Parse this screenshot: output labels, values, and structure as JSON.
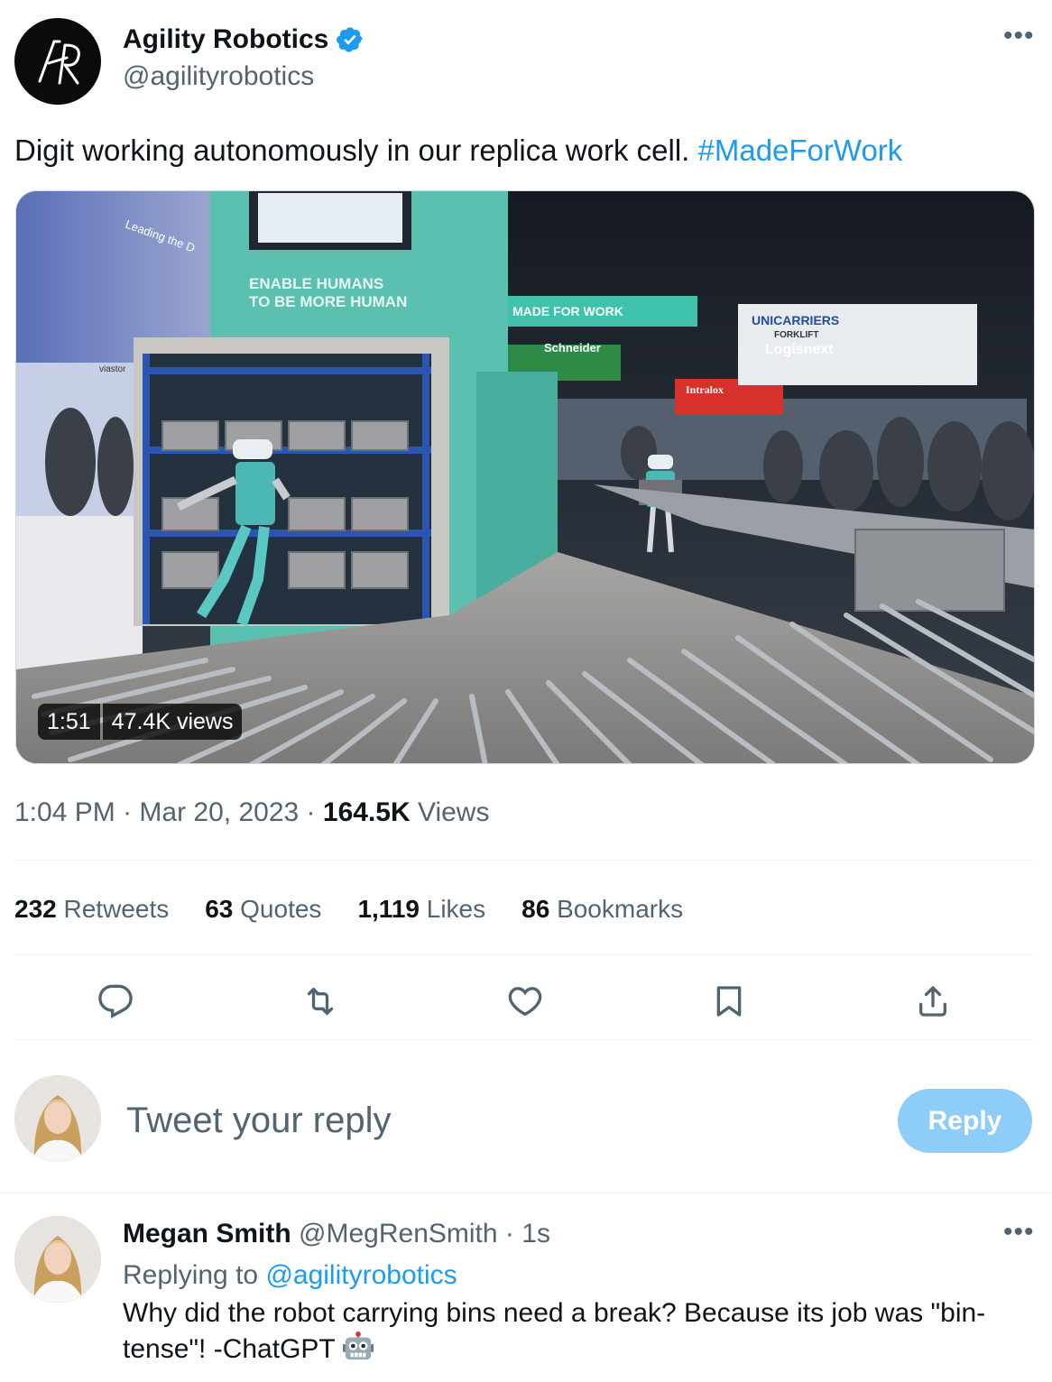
{
  "tweet": {
    "author_name": "Agility Robotics",
    "author_handle": "@agilityrobotics",
    "avatar_initials": "AR",
    "text": "Digit working autonomously in our replica work cell. ",
    "hashtag": "#MadeForWork",
    "video": {
      "duration": "1:51",
      "views": "47.4K views",
      "scene_signs": [
        "ENABLE HUMANS",
        "TO BE MORE HUMAN",
        "MADE FOR WORK",
        "Schneider",
        "UNICARRIERS",
        "FORKLIFT",
        "Logisnext",
        "Intralox",
        "Leading the D",
        "viastor"
      ]
    },
    "time": "1:04 PM",
    "date": "Mar 20, 2023",
    "views_count": "164.5K",
    "views_label": "Views",
    "sep": "·"
  },
  "stats": [
    {
      "count": "232",
      "label": "Retweets"
    },
    {
      "count": "63",
      "label": "Quotes"
    },
    {
      "count": "1,119",
      "label": "Likes"
    },
    {
      "count": "86",
      "label": "Bookmarks"
    }
  ],
  "actions": [
    "reply-icon",
    "retweet-icon",
    "like-icon",
    "bookmark-icon",
    "share-icon"
  ],
  "composer": {
    "placeholder": "Tweet your reply",
    "button": "Reply"
  },
  "reply": {
    "author_name": "Megan Smith",
    "author_handle": "@MegRenSmith",
    "time": "1s",
    "replying_prefix": "Replying to ",
    "replying_to": "@agilityrobotics",
    "text": "Why did the robot carrying bins need a break? Because its job was \"bin-tense\"! -ChatGPT ",
    "emoji": "robot-face-icon"
  },
  "colors": {
    "accent": "#1d9bf0",
    "reply_button": "#8ecdf8",
    "secondary_text": "#536471",
    "divider": "#eff3f4"
  }
}
